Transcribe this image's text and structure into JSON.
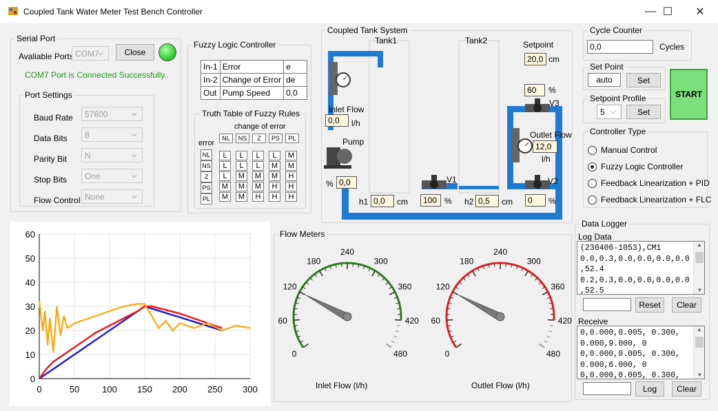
{
  "window": {
    "title": "Coupled Tank Water Meter Test Bench Controller",
    "min": "—",
    "max": "☐",
    "close": "✕"
  },
  "serial": {
    "group": "Serial Port",
    "ports_label": "Avaliable Ports",
    "port_value": "COM7",
    "close_btn": "Close",
    "status": "COM7 Port is Connected Successfully..",
    "status_color": "#1a9c1a",
    "led_color": "#2fd12f"
  },
  "port_settings": {
    "group": "Port Settings",
    "rows": [
      {
        "label": "Baud Rate",
        "value": "57600"
      },
      {
        "label": "Data Bits",
        "value": "8"
      },
      {
        "label": "Parity Bit",
        "value": "N"
      },
      {
        "label": "Stop Bits",
        "value": "One"
      },
      {
        "label": "Flow Control",
        "value": "None"
      }
    ]
  },
  "fuzzy": {
    "group": "Fuzzy Logic Controller",
    "rows": [
      [
        "In-1",
        "Error",
        "e"
      ],
      [
        "In-2",
        "Change of Error",
        "de"
      ],
      [
        "Out",
        "Pump Speed",
        "0,0"
      ]
    ],
    "truth_title": "Truth Table of Fuzzy Rules",
    "change_label": "change of error",
    "error_label": "error",
    "cols": [
      "NL",
      "NS",
      "Z",
      "PS",
      "PL"
    ],
    "rows_labels": [
      "NL",
      "NS",
      "Z",
      "PS",
      "PL"
    ],
    "rules": [
      [
        "L",
        "L",
        "L",
        "L",
        "M"
      ],
      [
        "L",
        "L",
        "L",
        "M",
        "M"
      ],
      [
        "L",
        "M",
        "M",
        "M",
        "H"
      ],
      [
        "M",
        "M",
        "M",
        "H",
        "H"
      ],
      [
        "M",
        "M",
        "H",
        "H",
        "H"
      ]
    ]
  },
  "tank": {
    "group": "Coupled Tank System",
    "tank1": "Tank1",
    "tank2": "Tank2",
    "setpoint_label": "Setpoint",
    "setpoint": "20,0",
    "setpoint_unit": "cm",
    "pct_top": "60",
    "pct": "%",
    "v3": "V3",
    "outlet_label": "Outlet Flow",
    "outlet": "12,0",
    "outlet_unit": "l/h",
    "inlet_label": "Inlet Flow",
    "inlet": "0,0",
    "inlet_unit": "l/h",
    "pump": "Pump",
    "pump_pct_label": "%",
    "pump_val": "0,0",
    "v1": "V1",
    "v1_val": "100",
    "v2": "V2",
    "v2_val": "0",
    "h1_label": "h1",
    "h1": "0,0",
    "h1_unit": "cm",
    "h2_label": "h2",
    "h2": "0,5",
    "h2_unit": "cm"
  },
  "cycle": {
    "group": "Cycle Counter",
    "value": "0,0",
    "unit": "Cycles"
  },
  "setpt": {
    "group": "Set Point",
    "value": "auto",
    "btn": "Set"
  },
  "profile": {
    "group": "Setpoint Profile",
    "value": "5",
    "btn": "Set"
  },
  "start": {
    "label": "START",
    "color": "#7be07b"
  },
  "ctrl": {
    "group": "Controller Type",
    "options": [
      "Manual Control",
      "Fuzzy Logic Controller",
      "Feedback Linearization + PID",
      "Feedback Linearization + FLC"
    ],
    "selected": 1
  },
  "logger": {
    "group": "Data Logger",
    "log_label": "Log Data",
    "log_lines": [
      "(230406-1053),CM1",
      "0.0,0.3,0.0,0.0,0.0,0.0",
      ",52.4",
      "0.2,0.3,0.0,0.0,0.0,0.0",
      ",52.5"
    ],
    "reset": "Reset",
    "clear": "Clear",
    "receive_label": "Receive",
    "rx_lines": [
      "0,0.000,0.005, 0.300,",
      "0.000,9.000, 0",
      "0,0.000,0.005, 0.300,",
      "0.000,6.000, 0",
      "0,0.000,0.005, 0.300,"
    ],
    "log_btn": "Log",
    "clear2": "Clear"
  },
  "meters": {
    "group": "Flow Meters",
    "ticks": [
      "0",
      "60",
      "120",
      "180",
      "240",
      "300",
      "360",
      "420",
      "480"
    ],
    "inlet_caption": "Inlet Flow (l/h)",
    "outlet_caption": "Outlet Flow (l/h)",
    "inlet_value": 0,
    "outlet_value": 12,
    "inlet_arc_color": "#2e7d1e",
    "outlet_arc_color": "#e02020"
  },
  "chart_data": {
    "type": "line",
    "xlim": [
      0,
      300
    ],
    "ylim": [
      0,
      60
    ],
    "xticks": [
      "0",
      "50",
      "100",
      "150",
      "200",
      "250",
      "300"
    ],
    "yticks": [
      "0",
      "10",
      "20",
      "30",
      "40",
      "50",
      "60"
    ],
    "grid": true,
    "series": [
      {
        "color": "#1d1dd6",
        "x": [
          0,
          150,
          260
        ],
        "y": [
          0,
          30,
          20
        ]
      },
      {
        "color": "#e81919",
        "x": [
          0,
          10,
          20,
          40,
          60,
          80,
          100,
          120,
          140,
          150,
          160,
          200,
          230,
          260
        ],
        "y": [
          0,
          4,
          7,
          11,
          15,
          19,
          22,
          25,
          28,
          30,
          30,
          27,
          24,
          21
        ]
      },
      {
        "color": "#ffa500",
        "x": [
          0,
          5,
          8,
          12,
          15,
          20,
          25,
          30,
          35,
          40,
          50,
          60,
          80,
          100,
          120,
          140,
          150,
          160,
          170,
          180,
          190,
          200,
          220,
          240,
          260,
          280,
          300
        ],
        "y": [
          32,
          20,
          28,
          14,
          25,
          11,
          30,
          18,
          26,
          21,
          23,
          24,
          26,
          28,
          30,
          31,
          31,
          26,
          21,
          24,
          20,
          23,
          21,
          23,
          20,
          22,
          21
        ]
      }
    ]
  }
}
